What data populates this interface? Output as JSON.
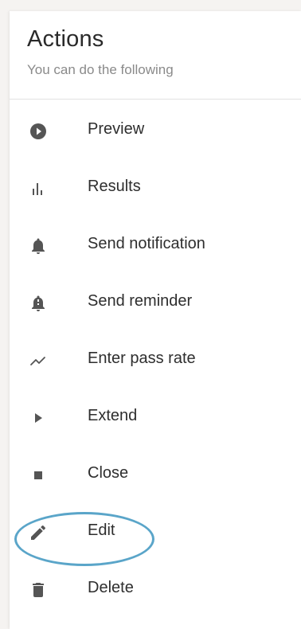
{
  "header": {
    "title": "Actions",
    "subtitle": "You can do the following"
  },
  "menu": {
    "items": [
      {
        "label": "Preview",
        "icon": "play-circle-icon"
      },
      {
        "label": "Results",
        "icon": "bar-chart-icon"
      },
      {
        "label": "Send notification",
        "icon": "bell-icon"
      },
      {
        "label": "Send reminder",
        "icon": "bell-alert-icon"
      },
      {
        "label": "Enter pass rate",
        "icon": "trend-line-icon"
      },
      {
        "label": "Extend",
        "icon": "play-arrow-icon"
      },
      {
        "label": "Close",
        "icon": "stop-square-icon"
      },
      {
        "label": "Edit",
        "icon": "pencil-icon"
      },
      {
        "label": "Delete",
        "icon": "trash-icon"
      }
    ],
    "highlighted_item": "Edit",
    "highlight_color": "#5aa5c9"
  }
}
